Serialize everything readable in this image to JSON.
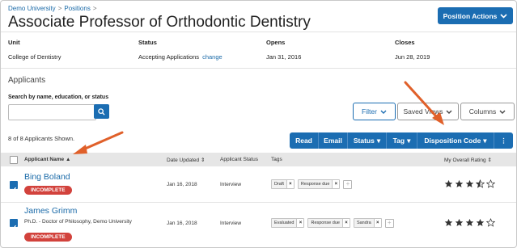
{
  "breadcrumb": {
    "root": "Demo University",
    "section": "Positions",
    "separator": ">"
  },
  "page_title": "Associate Professor of Orthodontic Dentistry",
  "position_actions_label": "Position Actions",
  "meta": [
    {
      "label": "Unit",
      "value": "College of Dentistry"
    },
    {
      "label": "Status",
      "value": "Accepting Applications",
      "link": "change"
    },
    {
      "label": "Opens",
      "value": "Jan 31, 2016"
    },
    {
      "label": "Closes",
      "value": "Jun 28, 2019"
    }
  ],
  "applicants_heading": "Applicants",
  "search": {
    "label": "Search by name, education, or status",
    "value": "",
    "placeholder": ""
  },
  "filters": {
    "filter": "Filter",
    "saved_views": "Saved Views",
    "columns": "Columns"
  },
  "shown_text": "8 of 8 Applicants Shown.",
  "action_bar": {
    "read": "Read",
    "email": "Email",
    "status": "Status",
    "tag": "Tag",
    "disposition": "Disposition Code",
    "more": "⋮"
  },
  "columns": {
    "name": "Applicant Name",
    "date_updated": "Date Updated",
    "applicant_status": "Applicant Status",
    "tags": "Tags",
    "rating": "My Overall Rating"
  },
  "applicants": [
    {
      "name": "Bing Boland",
      "degree": "",
      "badge": "INCOMPLETE",
      "date_updated": "Jan 16, 2018",
      "status": "Interview",
      "tags": [
        "Draft",
        "Response due"
      ],
      "rating": 3.5,
      "checked": true
    },
    {
      "name": "James Grimm",
      "degree": "Ph.D. - Doctor of Philosophy, Demo University",
      "badge": "INCOMPLETE",
      "date_updated": "Jan 16, 2018",
      "status": "Interview",
      "tags": [
        "Evaluated",
        "Response due",
        "Sandra"
      ],
      "rating": 4,
      "checked": true
    }
  ],
  "colors": {
    "primary": "#1b6db2",
    "badge": "#d2423c",
    "arrow": "#e0602a",
    "link": "#1a6aa8"
  },
  "icons": {
    "search": "search-icon",
    "chevron": "chevron-down-icon",
    "sort": "sort-icon",
    "star": "star-icon",
    "tag_remove": "close-icon",
    "tag_add": "plus-icon"
  }
}
